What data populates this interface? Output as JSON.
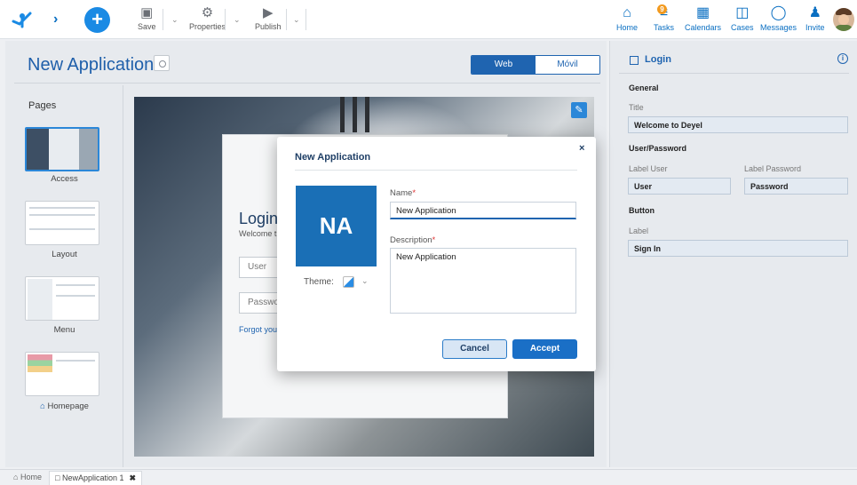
{
  "toolbar": {
    "save_label": "Save",
    "properties_label": "Properties",
    "publish_label": "Publish",
    "save_icon": "floppy-icon",
    "properties_icon": "gear-icon",
    "publish_icon": "play-icon"
  },
  "right_toolbar": {
    "items": [
      {
        "label": "Home",
        "icon": "home-icon"
      },
      {
        "label": "Tasks",
        "icon": "tasks-icon",
        "badge": "9"
      },
      {
        "label": "Calendars",
        "icon": "calendar-icon"
      },
      {
        "label": "Cases",
        "icon": "briefcase-icon"
      },
      {
        "label": "Messages",
        "icon": "chat-icon"
      },
      {
        "label": "Invite",
        "icon": "add-user-icon"
      }
    ]
  },
  "main": {
    "title": "New Application",
    "toggle": {
      "web": "Web",
      "mobile": "Móvil",
      "selected": "Web"
    }
  },
  "pages": {
    "heading": "Pages",
    "items": [
      {
        "label": "Access",
        "selected": true
      },
      {
        "label": "Layout",
        "selected": false
      },
      {
        "label": "Menu",
        "selected": false
      },
      {
        "label": "Homepage",
        "selected": false,
        "icon": "home-icon"
      }
    ]
  },
  "preview": {
    "title": "Login",
    "subtitle": "Welcome t",
    "user_placeholder": "User",
    "password_placeholder": "Passwo",
    "forgot": "Forgot you"
  },
  "right_panel": {
    "title": "Login",
    "general_heading": "General",
    "title_label": "Title",
    "title_value": "Welcome to Deyel",
    "userpass_heading": "User/Password",
    "label_user_label": "Label User",
    "label_user_value": "User",
    "label_password_label": "Label Password",
    "label_password_value": "Password",
    "button_heading": "Button",
    "button_label_label": "Label",
    "button_label_value": "Sign In"
  },
  "modal": {
    "title": "New Application",
    "close": "×",
    "initials": "NA",
    "theme_label": "Theme:",
    "name_label": "Name",
    "name_value": "New Application",
    "description_label": "Description",
    "description_value": "New Application",
    "required_mark": "*",
    "cancel": "Cancel",
    "accept": "Accept"
  },
  "bottom_tabs": {
    "home": "Home",
    "tab": "NewApplication 1"
  },
  "colors": {
    "accent": "#1f64b0",
    "primary_button": "#1a6fc6",
    "badge": "#f29a1f"
  }
}
